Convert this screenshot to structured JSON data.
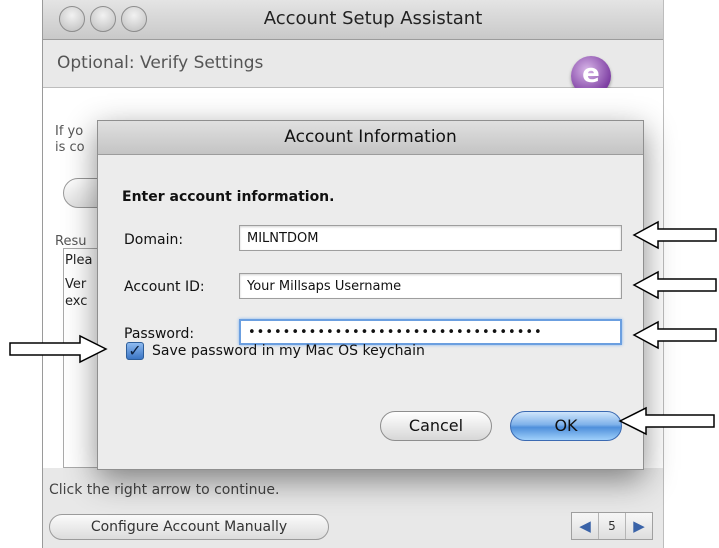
{
  "background_window": {
    "title": "Account Setup Assistant",
    "header": "Optional: Verify Settings",
    "logo_letter": "e",
    "fragments": [
      "If yo",
      "is co",
      "Resu",
      "Plea",
      "Ver",
      "exc"
    ],
    "footer_text": "Click the right arrow to continue.",
    "configure_button": "Configure Account Manually",
    "pager": {
      "prev": "◀",
      "page": "5",
      "next": "▶"
    }
  },
  "dialog": {
    "title": "Account Information",
    "heading": "Enter account information.",
    "domain": {
      "label": "Domain:",
      "value": "MILNTDOM"
    },
    "account_id": {
      "label": "Account ID:",
      "value": "Your Millsaps Username"
    },
    "password": {
      "label": "Password:",
      "value": "••••••••••••••••••••••••••••••••••"
    },
    "save_password": {
      "label": "Save password in my Mac OS keychain",
      "checked": true,
      "mark": "✓"
    },
    "cancel_label": "Cancel",
    "ok_label": "OK"
  },
  "accent_colors": {
    "ok_button": "#5a97de",
    "focus_ring": "#6b9fe0"
  }
}
